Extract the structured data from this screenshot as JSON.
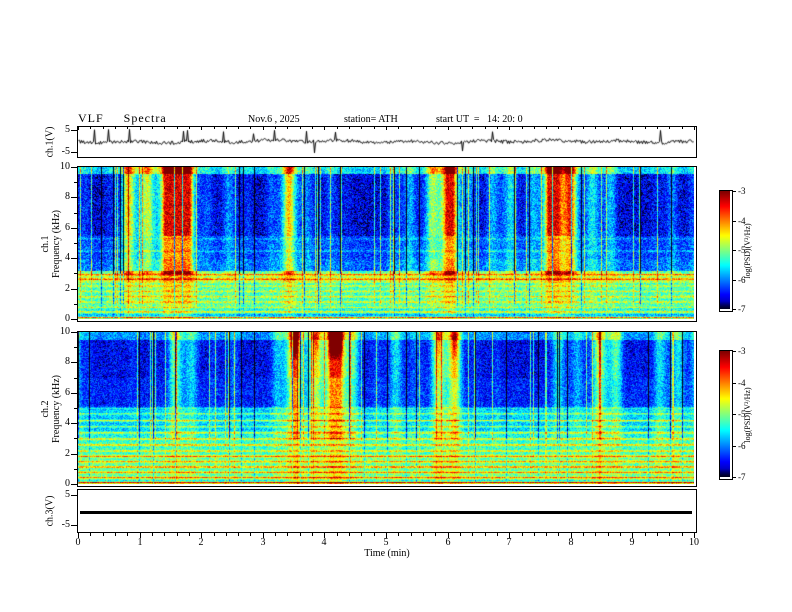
{
  "header": {
    "title": "VLF  Spectra",
    "date": "Nov.6 , 2025",
    "station": "station= ATH",
    "start_ut": "start UT  =   14: 20: 0"
  },
  "axes": {
    "x": {
      "label": "Time  (min)",
      "ticks": [
        "0",
        "1",
        "2",
        "3",
        "4",
        "5",
        "6",
        "7",
        "8",
        "9",
        "10"
      ],
      "range": [
        0,
        10
      ]
    },
    "wave_y": {
      "label": "ch.1(V)",
      "ticks": [
        "5",
        "-5"
      ],
      "range": [
        -5,
        5
      ]
    },
    "spec1_y": {
      "label_line1": "ch.1",
      "label_line2": "Frequency (kHz)",
      "ticks": [
        "10",
        "8",
        "6",
        "4",
        "2",
        "0"
      ],
      "range": [
        0,
        10
      ]
    },
    "spec2_y": {
      "label_line1": "ch.2",
      "label_line2": "Frequency (kHz)",
      "ticks": [
        "10",
        "8",
        "6",
        "4",
        "2",
        "0"
      ],
      "range": [
        0,
        10
      ]
    },
    "ch3_y": {
      "label": "ch.3(V)",
      "ticks": [
        "5",
        "-5"
      ],
      "range": [
        -5,
        5
      ]
    }
  },
  "colorbars": [
    {
      "label": "log(PSD)(V²/Hz)",
      "ticks": [
        "-3",
        "-4",
        "-5",
        "-6",
        "-7"
      ],
      "range": [
        -7,
        -3
      ]
    },
    {
      "label": "log(PSD)(V²/Hz)",
      "ticks": [
        "-3",
        "-4",
        "-5",
        "-6",
        "-7"
      ],
      "range": [
        -7,
        -3
      ]
    }
  ],
  "chart_data": [
    {
      "type": "line",
      "panel": "ch.1 time series",
      "ylabel": "ch.1(V)",
      "ylim": [
        -5,
        5
      ],
      "xlim": [
        0,
        10
      ],
      "xlabel": "Time (min)",
      "description": "Low-amplitude broadband noise fluctuating around 0 V with many intermittent impulsive spikes reaching toward +5/-5 V, densest between about 1 and 4 min."
    },
    {
      "type": "heatmap",
      "panel": "ch.1 spectrogram",
      "ylabel": "Frequency (kHz)",
      "ylim": [
        0,
        10
      ],
      "xlim": [
        0,
        10
      ],
      "colorbar_label": "log(PSD)(V²/Hz)",
      "zlim": [
        -7,
        -3
      ],
      "colormap": "rainbow (dark blue/black = -7 low, green ~ -5, red = -3 high)",
      "features": [
        "intense continuous red/yellow horizontal interference lines below ~3 kHz (strongest near 0.1 kHz and 2.6-3.0 kHz)",
        "green-cyan band between ~0.5 and 3 kHz",
        "dark blue low-power background between ~3.5 and 6 kHz",
        "frequent broadband vertical burst columns (sferics) spanning 3-10 kHz appearing green/yellow",
        "speckled bright green/yellow edge near 10 kHz",
        "occasional dark dropout columns spanning the full band"
      ]
    },
    {
      "type": "heatmap",
      "panel": "ch.2 spectrogram",
      "ylabel": "Frequency (kHz)",
      "ylim": [
        0,
        10
      ],
      "xlim": [
        0,
        10
      ],
      "colorbar_label": "log(PSD)(V²/Hz)",
      "zlim": [
        -7,
        -3
      ],
      "colormap": "rainbow (dark blue/black = -7 low, green ~ -5, red = -3 high)",
      "features": [
        "dense stack of yellow/red horizontal interference lines from 0 to ~5 kHz",
        "green-cyan background over the lower half (0-5 kHz)",
        "blue background above ~5 kHz crossed by vertical green burst columns",
        "orange/yellow enhanced patches near 8.5-10 kHz at several times",
        "strong continuous red line near 0.1 kHz"
      ]
    },
    {
      "type": "line",
      "panel": "ch.3 time series",
      "ylabel": "ch.3(V)",
      "ylim": [
        -5,
        5
      ],
      "xlim": [
        0,
        10
      ],
      "xlabel": "Time (min)",
      "description": "Constant flat thick black trace slightly below mid-scale (~0 V) for the entire 0-10 min record; no variation."
    }
  ]
}
